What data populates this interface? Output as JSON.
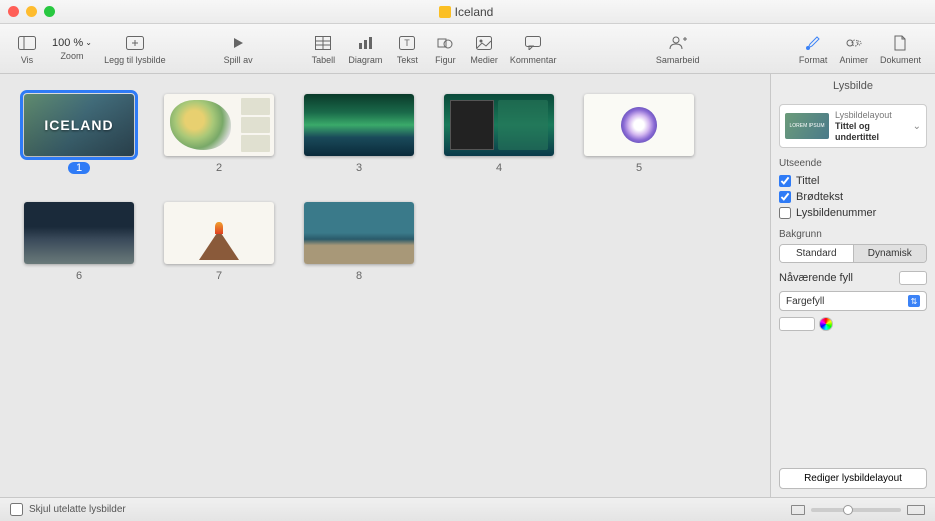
{
  "titlebar": {
    "doc_title": "Iceland"
  },
  "toolbar": {
    "vis": "Vis",
    "zoom": "Zoom",
    "zoom_value": "100 %",
    "add_slide": "Legg til lysbilde",
    "play": "Spill av",
    "table": "Tabell",
    "chart": "Diagram",
    "text": "Tekst",
    "shape": "Figur",
    "media": "Medier",
    "comment": "Kommentar",
    "collaborate": "Samarbeid",
    "format": "Format",
    "animate": "Animer",
    "document": "Dokument"
  },
  "slides": [
    {
      "num": "1",
      "title": "ICELAND",
      "selected": true
    },
    {
      "num": "2",
      "selected": false
    },
    {
      "num": "3",
      "selected": false
    },
    {
      "num": "4",
      "selected": false
    },
    {
      "num": "5",
      "selected": false
    },
    {
      "num": "6",
      "selected": false
    },
    {
      "num": "7",
      "selected": false
    },
    {
      "num": "8",
      "selected": false
    }
  ],
  "inspector": {
    "title": "Lysbilde",
    "layout_label": "Lysbildelayout",
    "layout_value": "Tittel og undertittel",
    "appearance_label": "Utseende",
    "chk_title": "Tittel",
    "chk_body": "Brødtekst",
    "chk_slidenum": "Lysbildenummer",
    "background_label": "Bakgrunn",
    "seg_standard": "Standard",
    "seg_dynamic": "Dynamisk",
    "current_fill": "Nåværende fyll",
    "fill_type": "Fargefyll",
    "edit_layout": "Rediger lysbildelayout"
  },
  "bottombar": {
    "hide_skipped": "Skjul utelatte lysbilder"
  },
  "colors": {
    "accent": "#2f7bf6"
  }
}
